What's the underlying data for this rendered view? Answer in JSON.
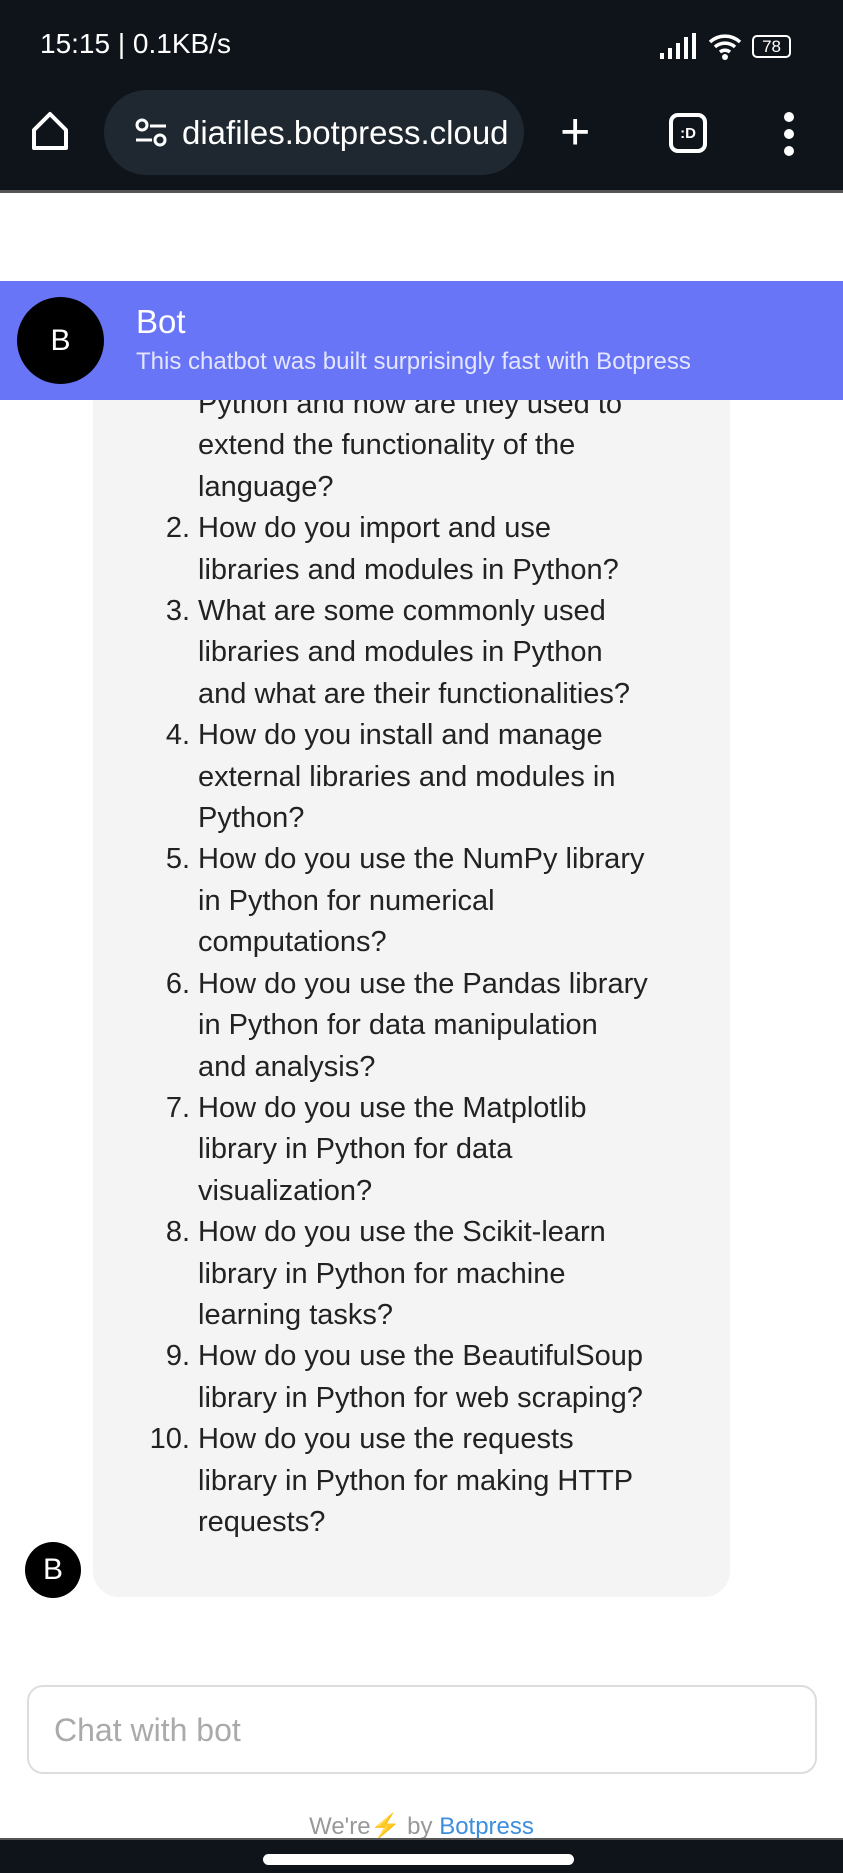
{
  "status_bar": {
    "time": "15:15 | 0.1KB/s",
    "battery": "78"
  },
  "browser": {
    "url": "diafiles.botpress.cloud",
    "tabs_label": ":D"
  },
  "header": {
    "avatar": "B",
    "name": "Bot",
    "description": "This chatbot was built surprisingly fast with Botpress"
  },
  "message": {
    "avatar": "B",
    "items": [
      {
        "num": "",
        "lines": [
          "Python and how are they used to",
          "extend the functionality of the",
          "language?"
        ]
      },
      {
        "num": "2.",
        "lines": [
          "How do you import and use",
          "libraries and modules in Python?"
        ]
      },
      {
        "num": "3.",
        "lines": [
          "What are some commonly used",
          "libraries and modules in Python",
          "and what are their functionalities?"
        ]
      },
      {
        "num": "4.",
        "lines": [
          "How do you install and manage",
          "external libraries and modules in",
          "Python?"
        ]
      },
      {
        "num": "5.",
        "lines": [
          "How do you use the NumPy library",
          "in Python for numerical",
          "computations?"
        ]
      },
      {
        "num": "6.",
        "lines": [
          "How do you use the Pandas library",
          "in Python for data manipulation",
          "and analysis?"
        ]
      },
      {
        "num": "7.",
        "lines": [
          "How do you use the Matplotlib",
          "library in Python for data",
          "visualization?"
        ]
      },
      {
        "num": "8.",
        "lines": [
          "How do you use the Scikit-learn",
          "library in Python for machine",
          "learning tasks?"
        ]
      },
      {
        "num": "9.",
        "lines": [
          "How do you use the BeautifulSoup",
          "library in Python for web scraping?"
        ]
      },
      {
        "num": "10.",
        "lines": [
          "How do you use the requests",
          "library in Python for making HTTP",
          "requests?"
        ]
      }
    ]
  },
  "composer": {
    "placeholder": "Chat with bot"
  },
  "footer": {
    "prefix": "We're",
    "bolt": "⚡",
    "by": "by",
    "link": "Botpress"
  }
}
